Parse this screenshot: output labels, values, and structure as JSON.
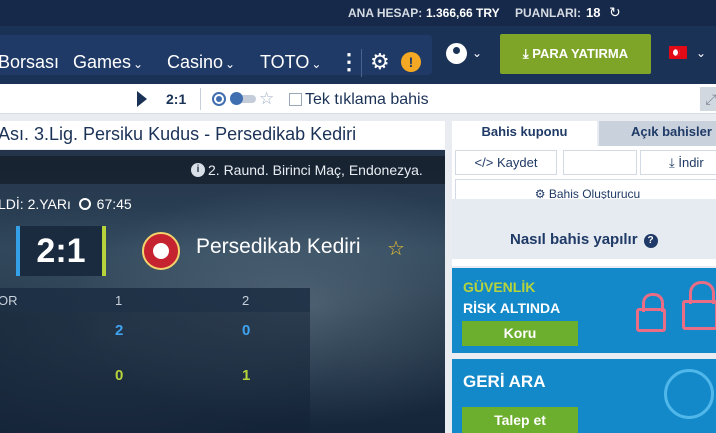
{
  "topbar": {
    "balance_label": "ANA HESAP:",
    "balance_value": "1.366,66 TRY",
    "points_label": "PUANLARI:",
    "points_value": "18"
  },
  "nav": {
    "items": [
      {
        "label": "Borsası",
        "chevron": ""
      },
      {
        "label": "Games",
        "chevron": "⌄"
      },
      {
        "label": "Casino",
        "chevron": "⌄"
      },
      {
        "label": "TOTO",
        "chevron": "⌄"
      }
    ],
    "deposit_label": "PARA YATIRMA",
    "warning_symbol": "!"
  },
  "subbar": {
    "score": "2:1",
    "quickbet_label": "Tek tıklama bahis"
  },
  "match": {
    "title": "Ası. 3.Lig. Persiku Kudus - Persedikab Kediri",
    "info": "2. Raund. Birinci Maç, Endonezya.",
    "status_prefix": "LDİ: 2.YARı",
    "time": "67:45",
    "score": "2:1",
    "team": "Persedikab Kediri",
    "stats": {
      "row_label": "OR",
      "col1": "1",
      "col2": "2",
      "row1": [
        "2",
        "0"
      ],
      "row2": [
        "0",
        "1"
      ]
    }
  },
  "coupon": {
    "tab_active": "Bahis kuponu",
    "tab_inactive": "Açık bahisler",
    "save_label": "Kaydet",
    "download_label": "İndir",
    "builder_label": "Bahis Oluşturucu",
    "howto_label": "Nasıl bahis yapılır"
  },
  "promos": {
    "security_line1": "GÜVENLİK",
    "security_line2": "RİSK ALTINDA",
    "security_button": "Koru",
    "callback_title": "GERİ ARA",
    "callback_button": "Talep et"
  },
  "colors": {
    "header": "#16294a",
    "nav": "#1b3257",
    "accent_green": "#7ea528",
    "promo_blue": "#1389c9",
    "score_blue": "#3fa3f0",
    "score_green": "#b6d33c"
  }
}
